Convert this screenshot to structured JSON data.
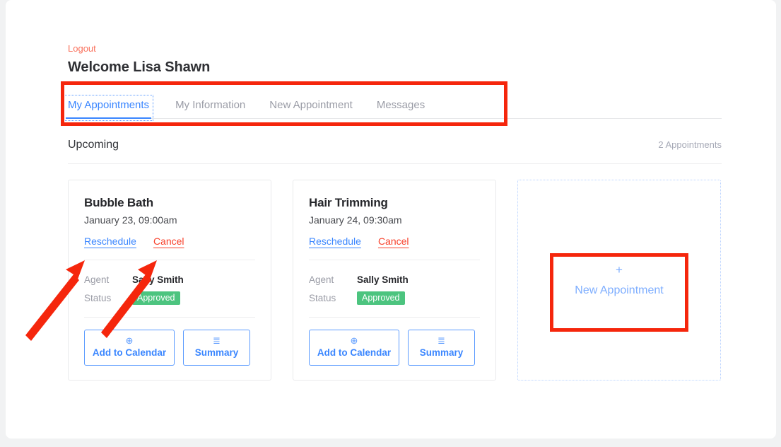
{
  "header": {
    "logout_label": "Logout",
    "welcome_title": "Welcome Lisa Shawn"
  },
  "tabs": [
    {
      "label": "My Appointments",
      "active": true
    },
    {
      "label": "My Information",
      "active": false
    },
    {
      "label": "New Appointment",
      "active": false
    },
    {
      "label": "Messages",
      "active": false
    }
  ],
  "section": {
    "title": "Upcoming",
    "count_label": "2 Appointments"
  },
  "appointments": [
    {
      "title": "Bubble Bath",
      "date": "January 23, 09:00am",
      "reschedule_label": "Reschedule",
      "cancel_label": "Cancel",
      "agent_label": "Agent",
      "agent_value": "Sally Smith",
      "status_label": "Status",
      "status_value": "Approved",
      "add_calendar_label": "Add to Calendar",
      "summary_label": "Summary"
    },
    {
      "title": "Hair Trimming",
      "date": "January 24, 09:30am",
      "reschedule_label": "Reschedule",
      "cancel_label": "Cancel",
      "agent_label": "Agent",
      "agent_value": "Sally Smith",
      "status_label": "Status",
      "status_value": "Approved",
      "add_calendar_label": "Add to Calendar",
      "summary_label": "Summary"
    }
  ],
  "new_appointment_card": {
    "plus_glyph": "+",
    "label": "New Appointment"
  },
  "colors": {
    "accent_blue": "#3a86ff",
    "logout_coral": "#f9705b",
    "cancel_red": "#f8402a",
    "status_green": "#4cc47f",
    "annotation_red": "#f5260c",
    "muted_text": "#9a9ca6"
  }
}
